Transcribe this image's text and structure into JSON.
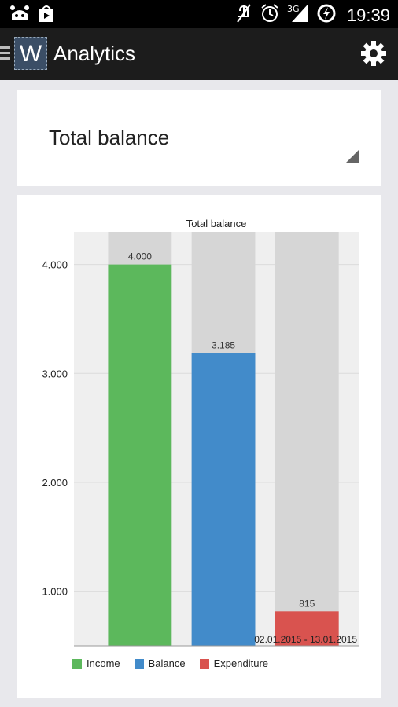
{
  "status_bar": {
    "time": "19:39",
    "network": "3G",
    "icons": [
      "android-icon",
      "play-store-icon",
      "mute-icon",
      "alarm-icon",
      "signal-icon",
      "battery-charging-icon"
    ]
  },
  "app": {
    "logo_letter": "W",
    "title": "Analytics",
    "settings_icon": "gear-icon"
  },
  "selector": {
    "value": "Total balance"
  },
  "chart_data": {
    "type": "bar",
    "title": "Total balance",
    "categories": [
      "Income",
      "Balance",
      "Expenditure"
    ],
    "values": [
      4000,
      3185,
      815
    ],
    "value_labels": [
      "4.000",
      "3.185",
      "815"
    ],
    "colors": [
      "#5cb85c",
      "#428bca",
      "#d9534f"
    ],
    "background_bar_color": "#d6d6d6",
    "ylim": [
      500,
      4300
    ],
    "yticks": [
      1000,
      2000,
      3000,
      4000
    ],
    "ytick_labels": [
      "1.000",
      "2.000",
      "3.000",
      "4.000"
    ],
    "xlabel": "02.01.2015 - 13.01.2015",
    "ylabel": "",
    "grid": true,
    "legend_position": "bottom-left"
  }
}
